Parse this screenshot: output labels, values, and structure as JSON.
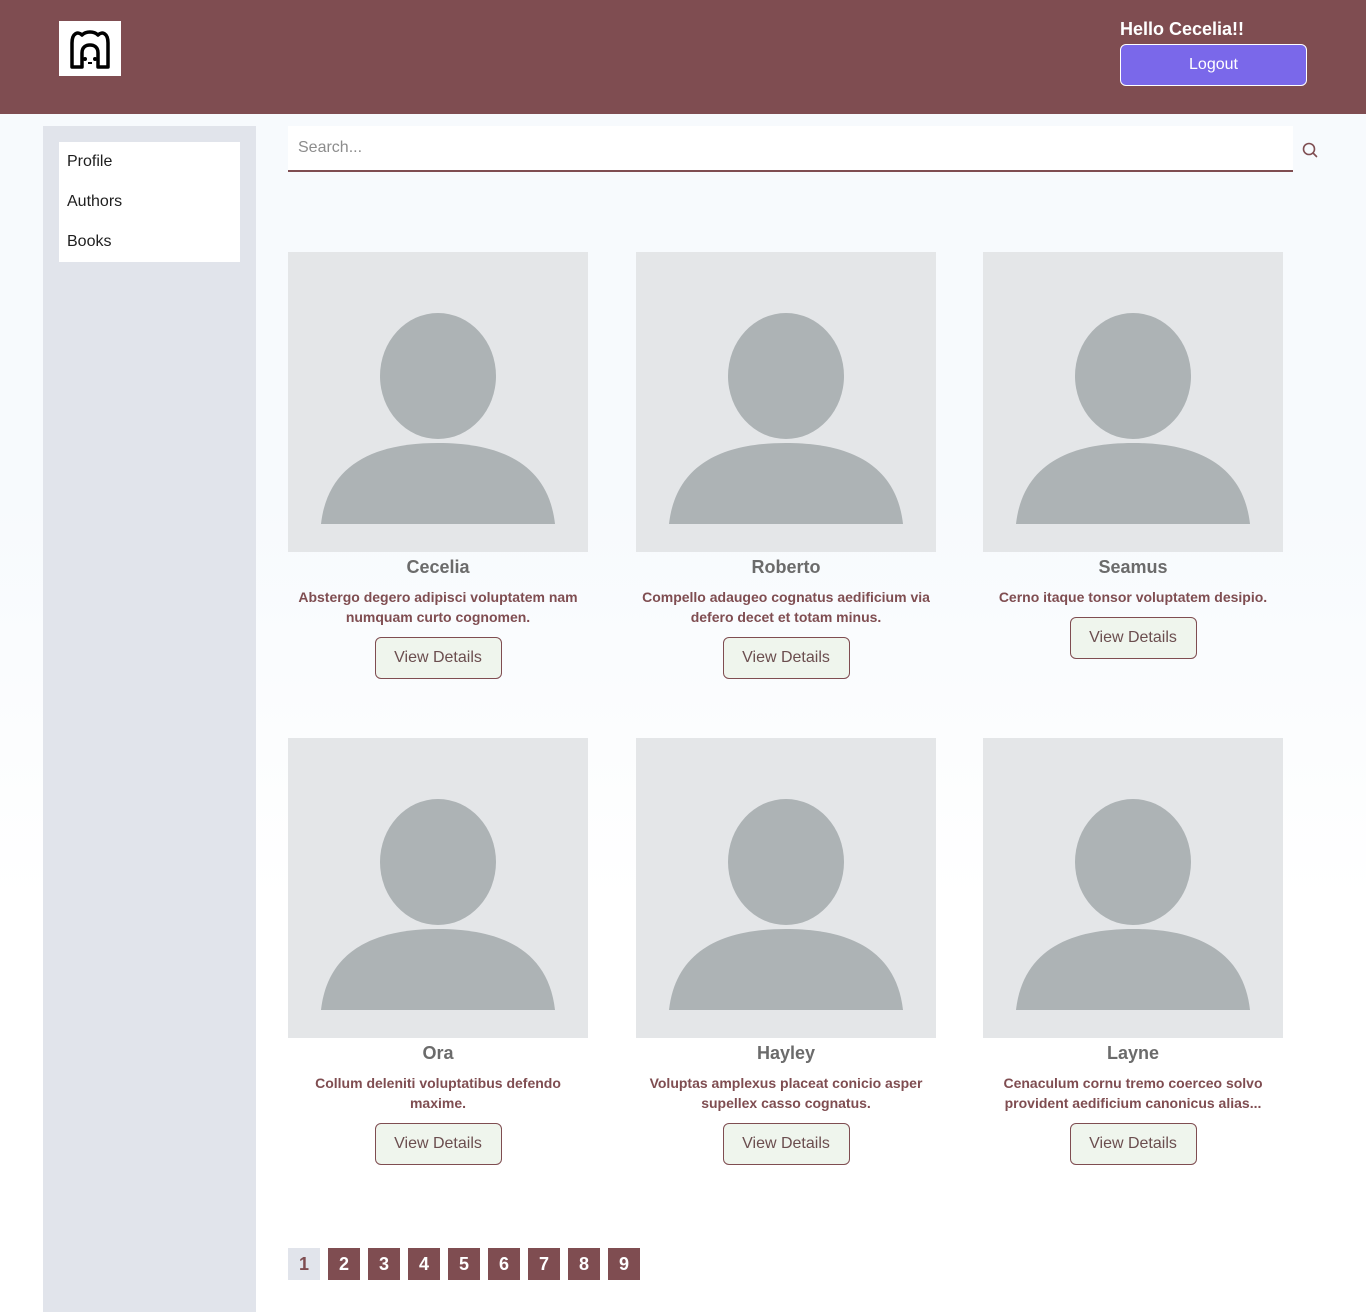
{
  "header": {
    "logo_icon": "bear-logo-icon",
    "greeting": "Hello Cecelia!!",
    "logout_label": "Logout"
  },
  "sidebar": {
    "items": [
      {
        "label": "Profile"
      },
      {
        "label": "Authors"
      },
      {
        "label": "Books"
      }
    ]
  },
  "search": {
    "placeholder": "Search...",
    "icon": "search-icon"
  },
  "authors": [
    {
      "name": "Cecelia",
      "description": "Abstergo degero adipisci voluptatem nam numquam curto cognomen.",
      "button": "View Details"
    },
    {
      "name": "Roberto",
      "description": "Compello adaugeo cognatus aedificium via defero decet et totam minus.",
      "button": "View Details"
    },
    {
      "name": "Seamus",
      "description": "Cerno itaque tonsor voluptatem desipio.",
      "button": "View Details"
    },
    {
      "name": "Ora",
      "description": "Collum deleniti voluptatibus defendo maxime.",
      "button": "View Details"
    },
    {
      "name": "Hayley",
      "description": "Voluptas amplexus placeat conicio asper supellex casso cognatus.",
      "button": "View Details"
    },
    {
      "name": "Layne",
      "description": "Cenaculum cornu tremo coerceo solvo provident aedificium canonicus alias...",
      "button": "View Details"
    }
  ],
  "pagination": {
    "pages": [
      "1",
      "2",
      "3",
      "4",
      "5",
      "6",
      "7",
      "8",
      "9"
    ],
    "current": "1"
  },
  "colors": {
    "brand": "#7f4d51",
    "accent": "#7a68ea",
    "sidebar_bg": "#e1e4eb",
    "button_bg": "#eff5ed"
  }
}
